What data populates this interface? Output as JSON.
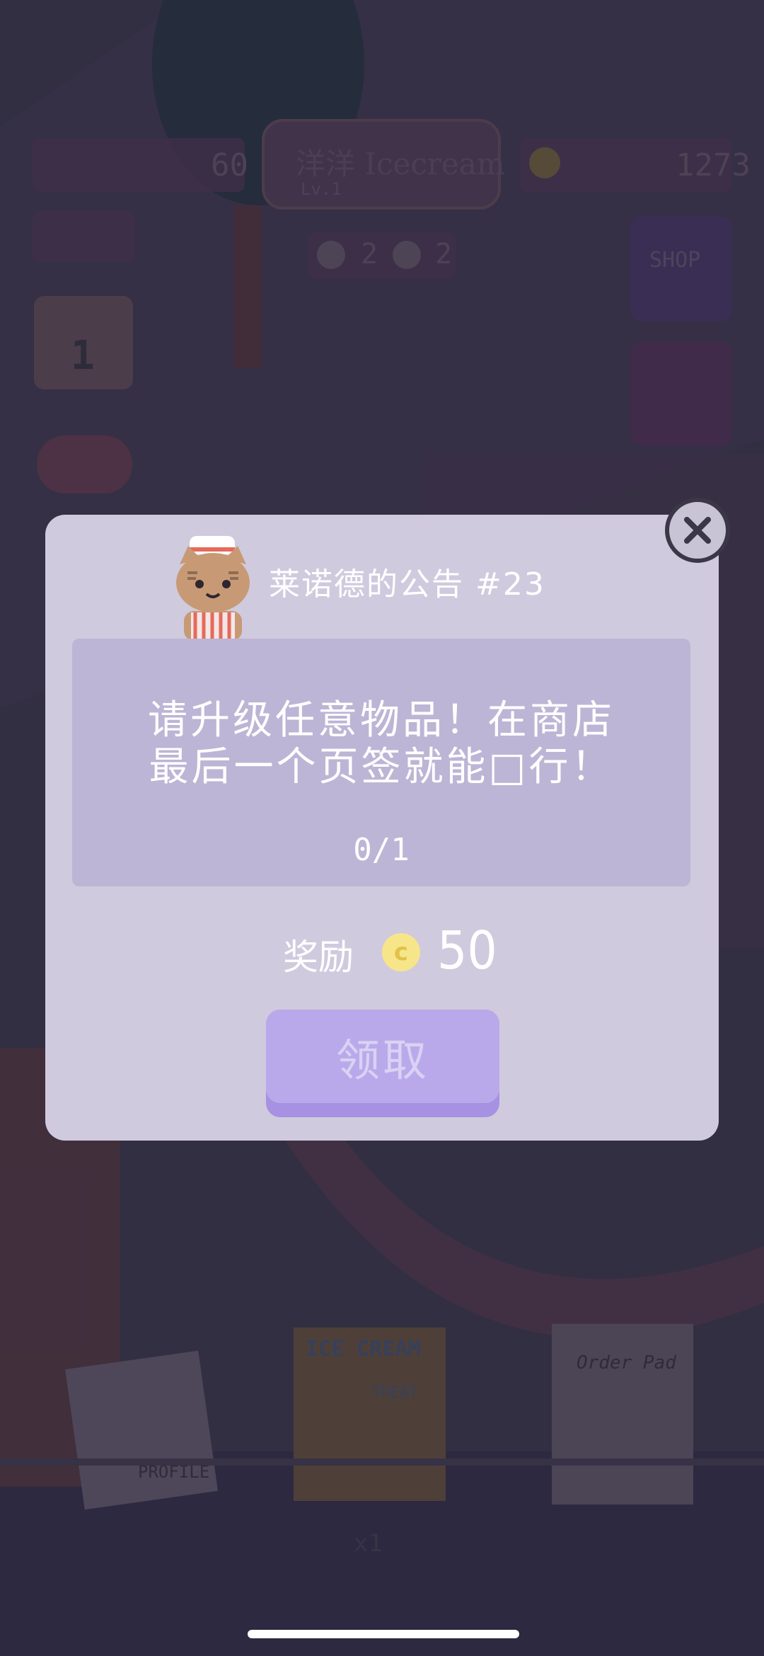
{
  "hud": {
    "left_counter": "60",
    "shop_name": "洋洋 Icecream",
    "shop_level": "Lv.1",
    "dog_count": "2",
    "cat_count": "2",
    "coins": "1273",
    "calendar_day": "1",
    "shop_button": "SHOP"
  },
  "scene": {
    "poster_title": "ICE CREAM",
    "poster_sub": "TREAT",
    "profile_label": "PROFILE",
    "order_pad": "Order Pad",
    "poster_multiplier": "x1"
  },
  "dialog": {
    "title": "莱诺德的公告 #23",
    "message_line1": "请升级任意物品！在商店",
    "message_line2": "最后一个页签就能□行！",
    "progress": "0/1",
    "reward_label": "奖励",
    "reward_value": "50",
    "claim_label": "领取"
  },
  "colors": {
    "dialog_bg": "#d0cade",
    "panel_bg": "#bdb5d5",
    "claim_button": "#baa9ea",
    "coin": "#f7e58a"
  },
  "icons": [
    "close-icon",
    "coin-icon",
    "cat-chef-icon",
    "calendar-icon",
    "gamepad-icon",
    "shop-icon",
    "treasure-chest-icon",
    "dog-icon",
    "cat-icon"
  ]
}
